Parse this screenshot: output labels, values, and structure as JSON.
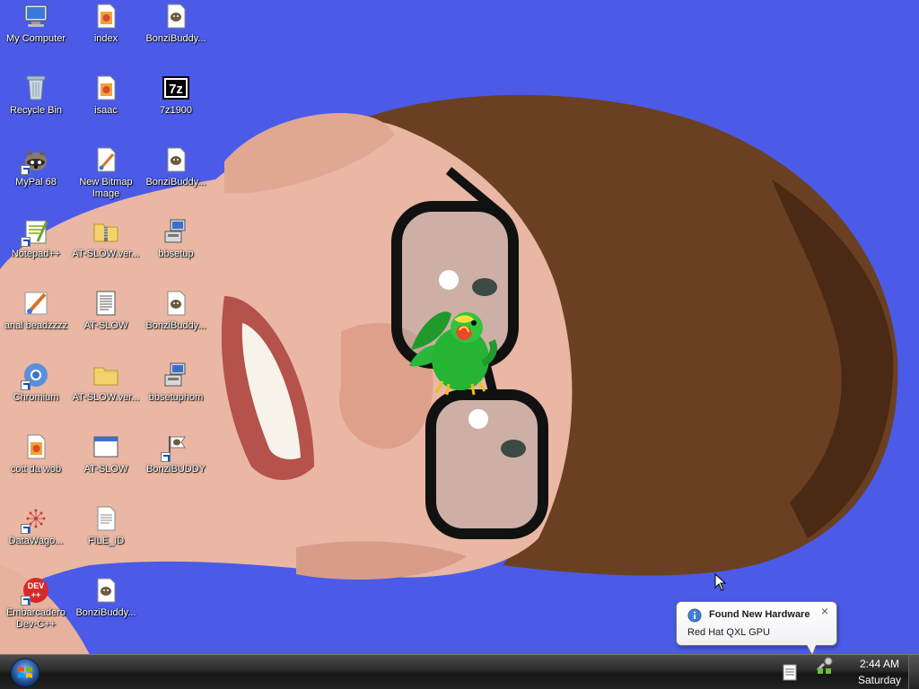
{
  "desktop": {
    "background_color": "#4b5be8",
    "icons": [
      {
        "label": "My Computer",
        "icon": "computer-icon"
      },
      {
        "label": "Recycle Bin",
        "icon": "recycle-bin-icon"
      },
      {
        "label": "MyPal 68",
        "icon": "raccoon-icon"
      },
      {
        "label": "Notepad++",
        "icon": "notepad-plus-icon"
      },
      {
        "label": "anal beadzzzz",
        "icon": "paint-icon"
      },
      {
        "label": "Chromium",
        "icon": "chromium-icon"
      },
      {
        "label": "cott da wob",
        "icon": "html-file-icon"
      },
      {
        "label": "DataWago...",
        "icon": "datawagon-icon"
      },
      {
        "label": "Embarcadero Dev-C++",
        "icon": "devcpp-icon"
      },
      {
        "label": "index",
        "icon": "html-file-icon"
      },
      {
        "label": "isaac",
        "icon": "html-file-icon"
      },
      {
        "label": "New Bitmap Image",
        "icon": "bitmap-icon"
      },
      {
        "label": "AT-SLOW.ver...",
        "icon": "zip-folder-icon"
      },
      {
        "label": "AT-SLOW",
        "icon": "text-document-icon"
      },
      {
        "label": "AT-SLOW.ver...",
        "icon": "folder-icon"
      },
      {
        "label": "AT-SLOW",
        "icon": "application-window-icon"
      },
      {
        "label": "FILE_ID",
        "icon": "text-file-icon"
      },
      {
        "label": "BonziBuddy...",
        "icon": "bonzi-file-icon"
      },
      {
        "label": "BonziBuddy...",
        "icon": "bonzi-file-icon"
      },
      {
        "label": "7z1900",
        "icon": "7zip-icon"
      },
      {
        "label": "BonziBuddy...",
        "icon": "bonzi-file-icon"
      },
      {
        "label": "bbsetup",
        "icon": "installer-icon"
      },
      {
        "label": "BonziBuddy...",
        "icon": "bonzi-file-icon"
      },
      {
        "label": "bbsetuphom",
        "icon": "installer-icon"
      },
      {
        "label": "BonziBUDDY",
        "icon": "bonzi-flag-icon"
      }
    ]
  },
  "agent": {
    "name": "parrot-agent"
  },
  "notification": {
    "title": "Found New Hardware",
    "text": "Red Hat QXL GPU",
    "close_label": "×"
  },
  "taskbar": {
    "start_label": "Start",
    "clock": {
      "time": "2:44 AM",
      "day": "Saturday"
    }
  }
}
